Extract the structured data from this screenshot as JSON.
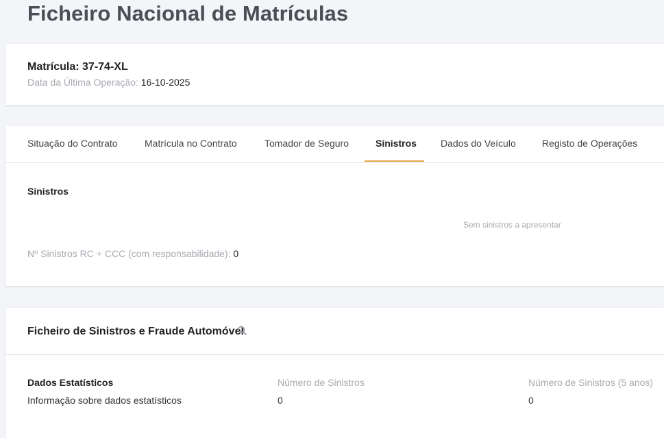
{
  "page": {
    "title": "Ficheiro Nacional de Matrículas"
  },
  "vehicle": {
    "plate_label": "Matrícula: 37-74-XL",
    "last_op_label": "Data da Última Operação:",
    "last_op_value": "16-10-2025"
  },
  "tabs": [
    {
      "label": "Situação do Contrato",
      "active": false
    },
    {
      "label": "Matrícula no Contrato",
      "active": false
    },
    {
      "label": "Tomador de Seguro",
      "active": false
    },
    {
      "label": "Sinistros",
      "active": true
    },
    {
      "label": "Dados do Veículo",
      "active": false
    },
    {
      "label": "Registo de Operações",
      "active": false
    }
  ],
  "claims": {
    "title": "Sinistros",
    "empty_message": "Sem sinistros a apresentar",
    "count_label": "Nº Sinistros RC + CCC (com responsabilidade):",
    "count_value": "0"
  },
  "fraud": {
    "title": "Ficheiro de Sinistros e Fraude Automóvel",
    "search_icon": "search-icon",
    "stats": {
      "col1_header": "Dados Estatísticos",
      "col1_value": "Informação sobre dados estatísticos",
      "col2_header": "Número de Sinistros",
      "col2_value": "0",
      "col3_header": "Número de Sinistros (5 anos)",
      "col3_value": "0"
    }
  },
  "colors": {
    "accent": "#e0a94a",
    "background": "#f3f5f8",
    "muted_text": "#a6aab0"
  }
}
